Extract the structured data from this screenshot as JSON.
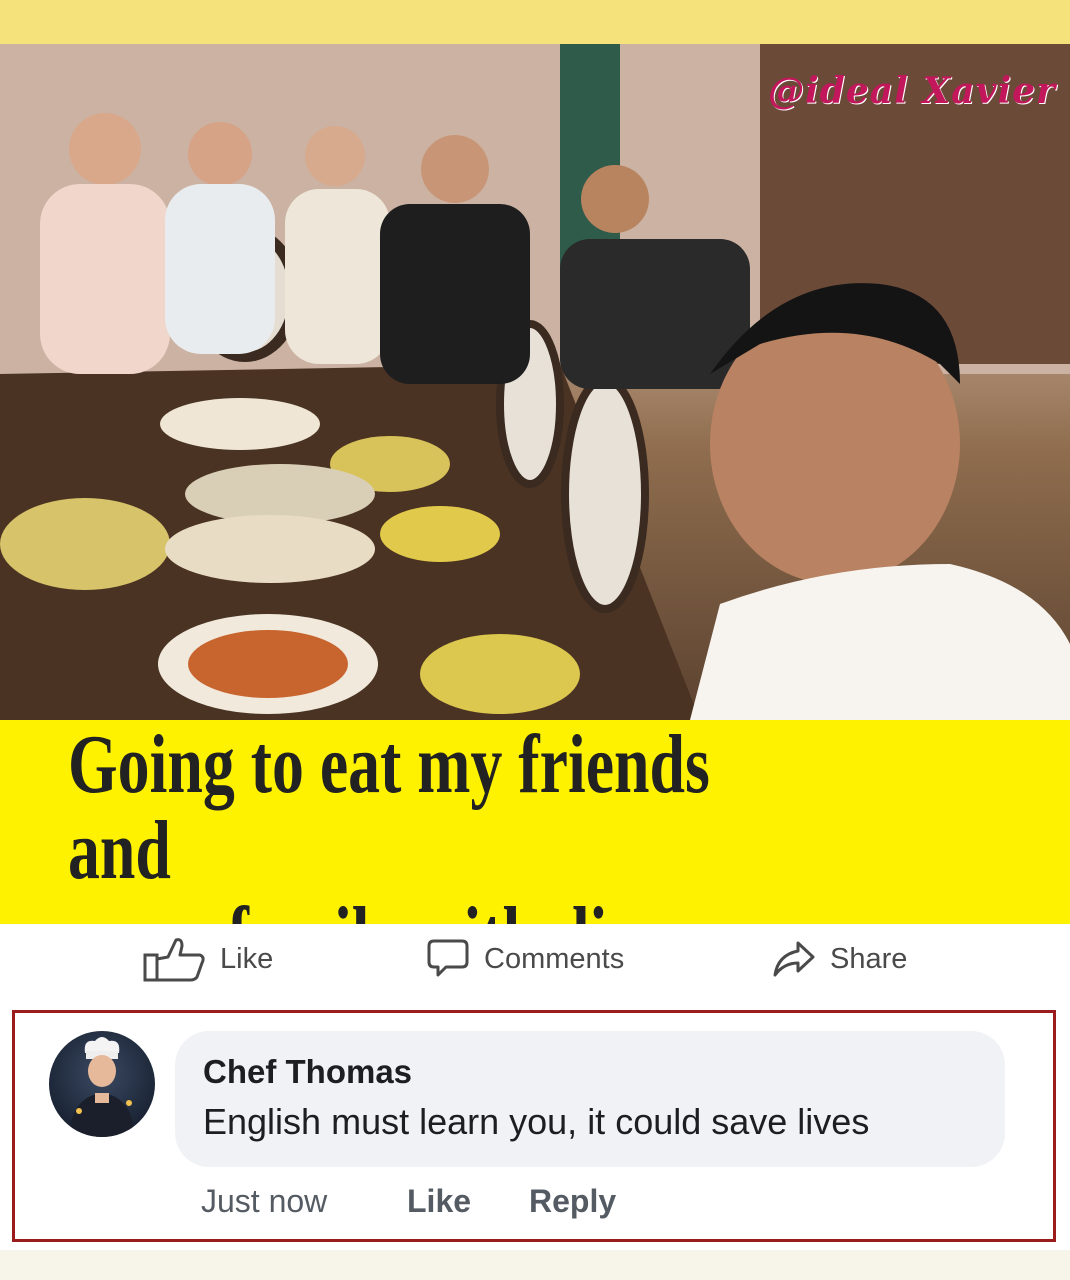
{
  "photo": {
    "watermark": "@ideal Xavier"
  },
  "caption": {
    "line1": "Going to eat my friends and",
    "line2": "family with dinner"
  },
  "actions": {
    "like_label": "Like",
    "comments_label": "Comments",
    "share_label": "Share"
  },
  "comment": {
    "author": "Chef Thomas",
    "text": "English must learn you, it could save lives",
    "timestamp": "Just now",
    "like_label": "Like",
    "reply_label": "Reply"
  },
  "colors": {
    "caption_bg": "#fff200",
    "frame_border": "#9b1c1c",
    "bubble_bg": "#f0f2f5",
    "watermark": "#c2185b"
  }
}
